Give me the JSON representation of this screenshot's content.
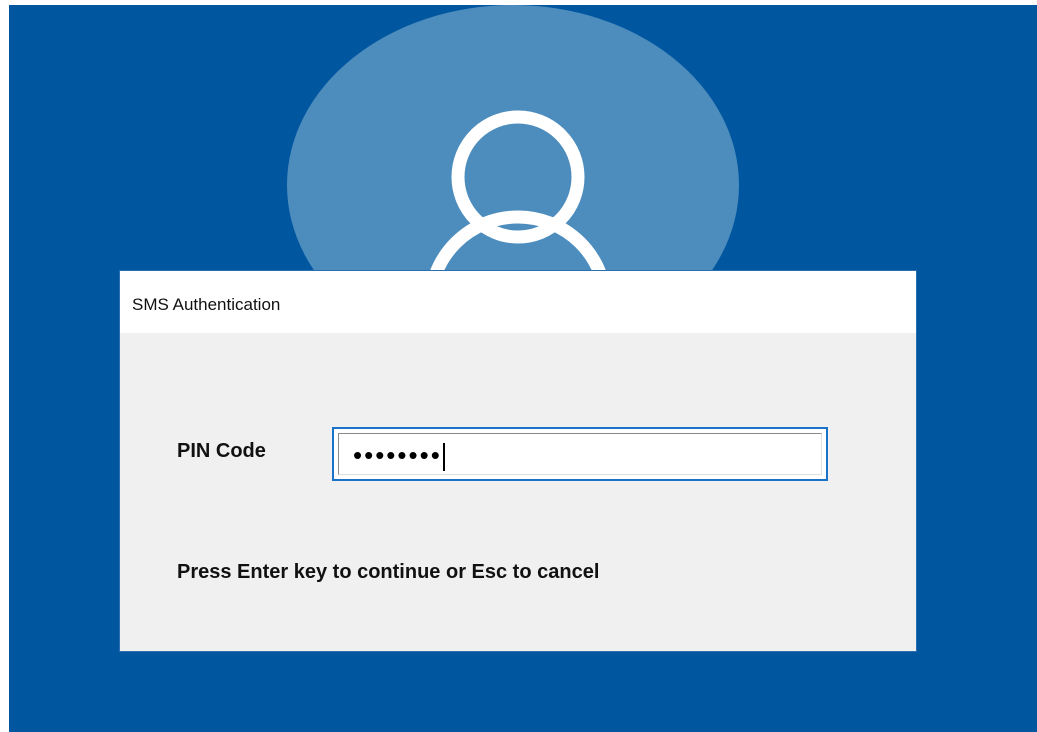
{
  "dialog": {
    "title": "SMS Authentication",
    "pin_label": "PIN Code",
    "pin_value": "••••••••",
    "hint": "Press Enter key to continue or Esc to cancel"
  },
  "colors": {
    "background": "#0057a0",
    "avatar_circle": "#4d8dbd",
    "input_border": "#1a73c8"
  },
  "icons": {
    "avatar": "user-silhouette-icon"
  }
}
